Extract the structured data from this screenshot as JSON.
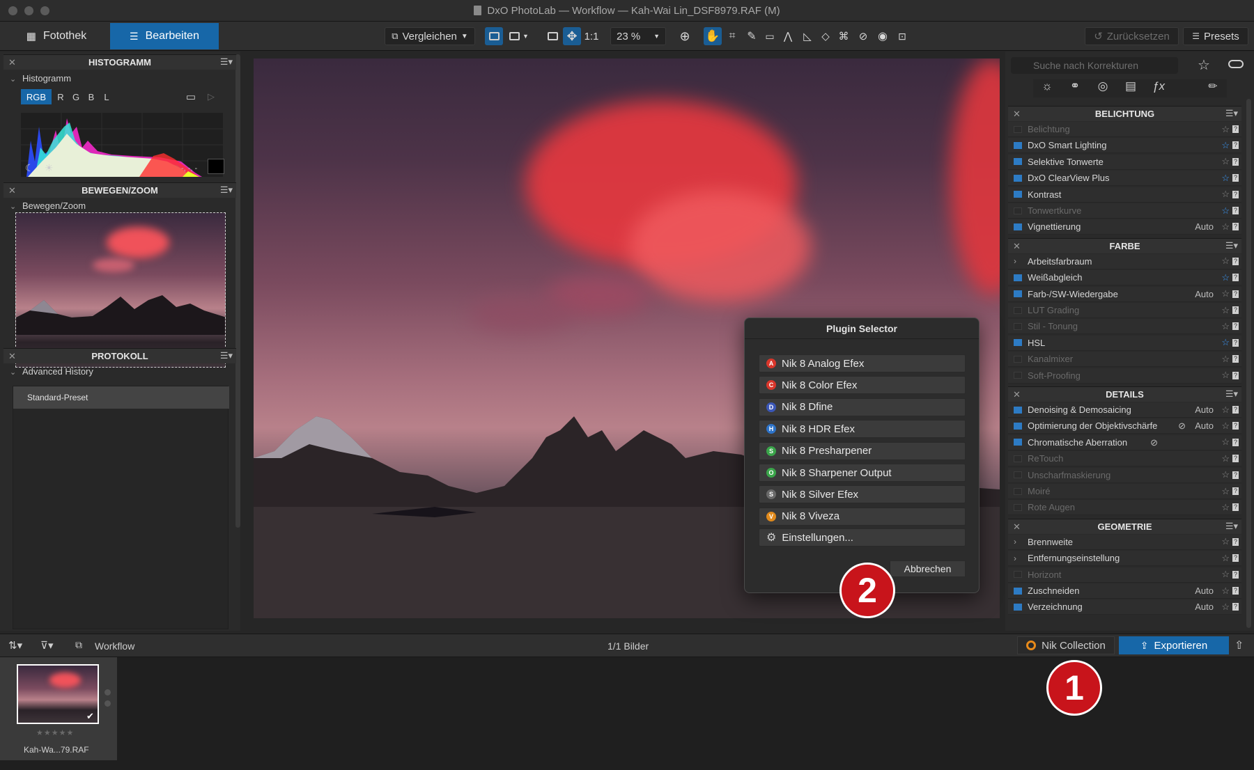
{
  "window": {
    "title": "DxO PhotoLab — Workflow — Kah-Wai Lin_DSF8979.RAF (M)"
  },
  "toolbar": {
    "tab_library": "Fotothek",
    "tab_edit": "Bearbeiten",
    "compare": "Vergleichen",
    "one_to_one": "1:1",
    "zoom": "23 %",
    "reset": "Zurücksetzen",
    "presets": "Presets"
  },
  "histogram": {
    "header": "HISTOGRAMM",
    "sub": "Histogramm",
    "channels": [
      "RGB",
      "R",
      "G",
      "B",
      "L"
    ],
    "readout": "-, -, -"
  },
  "navigator": {
    "header": "BEWEGEN/ZOOM",
    "sub": "Bewegen/Zoom"
  },
  "history": {
    "header": "PROTOKOLL",
    "sub": "Advanced History",
    "items": [
      "Standard-Preset"
    ]
  },
  "right": {
    "search_placeholder": "Suche nach Korrekturen",
    "sections": [
      {
        "title": "BELICHTUNG",
        "rows": [
          {
            "label": "Belichtung",
            "active": false,
            "starred": false,
            "auto": ""
          },
          {
            "label": "DxO Smart Lighting",
            "active": true,
            "starred": true,
            "auto": ""
          },
          {
            "label": "Selektive Tonwerte",
            "active": true,
            "starred": false,
            "auto": ""
          },
          {
            "label": "DxO ClearView Plus",
            "active": true,
            "starred": true,
            "auto": ""
          },
          {
            "label": "Kontrast",
            "active": true,
            "starred": false,
            "auto": ""
          },
          {
            "label": "Tonwertkurve",
            "active": false,
            "starred": true,
            "auto": ""
          },
          {
            "label": "Vignettierung",
            "active": true,
            "starred": false,
            "auto": "Auto"
          }
        ]
      },
      {
        "title": "FARBE",
        "rows": [
          {
            "label": "Arbeitsfarbraum",
            "chevron": true,
            "active": true,
            "starred": false,
            "auto": ""
          },
          {
            "label": "Weißabgleich",
            "active": true,
            "starred": true,
            "auto": ""
          },
          {
            "label": "Farb-/SW-Wiedergabe",
            "active": true,
            "starred": false,
            "auto": "Auto"
          },
          {
            "label": "LUT Grading",
            "active": false,
            "starred": false,
            "auto": ""
          },
          {
            "label": "Stil - Tonung",
            "active": false,
            "starred": false,
            "auto": ""
          },
          {
            "label": "HSL",
            "active": true,
            "starred": true,
            "auto": ""
          },
          {
            "label": "Kanalmixer",
            "active": false,
            "starred": false,
            "auto": ""
          },
          {
            "label": "Soft-Proofing",
            "active": false,
            "starred": false,
            "auto": ""
          }
        ]
      },
      {
        "title": "DETAILS",
        "rows": [
          {
            "label": "Denoising & Demosaicing",
            "active": true,
            "starred": false,
            "auto": "Auto"
          },
          {
            "label": "Optimierung der Objektivschärfe",
            "active": true,
            "starred": false,
            "auto": "Auto",
            "eye": true
          },
          {
            "label": "Chromatische Aberration",
            "active": true,
            "starred": false,
            "auto": "",
            "eye": true
          },
          {
            "label": "ReTouch",
            "active": false,
            "starred": false,
            "auto": ""
          },
          {
            "label": "Unscharfmaskierung",
            "active": false,
            "starred": false,
            "auto": ""
          },
          {
            "label": "Moiré",
            "active": false,
            "starred": false,
            "auto": ""
          },
          {
            "label": "Rote Augen",
            "active": false,
            "starred": false,
            "auto": ""
          }
        ]
      },
      {
        "title": "GEOMETRIE",
        "rows": [
          {
            "label": "Brennweite",
            "chevron": true,
            "active": true,
            "starred": false,
            "auto": ""
          },
          {
            "label": "Entfernungseinstellung",
            "chevron": true,
            "active": true,
            "starred": false,
            "auto": ""
          },
          {
            "label": "Horizont",
            "active": false,
            "starred": false,
            "auto": ""
          },
          {
            "label": "Zuschneiden",
            "active": true,
            "starred": false,
            "auto": "Auto"
          },
          {
            "label": "Verzeichnung",
            "active": true,
            "starred": false,
            "auto": "Auto"
          }
        ]
      }
    ]
  },
  "plugin_dialog": {
    "title": "Plugin Selector",
    "items": [
      {
        "label": "Nik 8 Analog Efex",
        "icon": "A",
        "color": "#d9362b"
      },
      {
        "label": "Nik 8 Color Efex",
        "icon": "C",
        "color": "#d9362b"
      },
      {
        "label": "Nik 8 Dfine",
        "icon": "D",
        "color": "#3b57b8"
      },
      {
        "label": "Nik 8 HDR Efex",
        "icon": "H",
        "color": "#2d73c8"
      },
      {
        "label": "Nik 8 Presharpener",
        "icon": "S",
        "color": "#3aa54a"
      },
      {
        "label": "Nik 8 Sharpener Output",
        "icon": "O",
        "color": "#3aa54a"
      },
      {
        "label": "Nik 8 Silver Efex",
        "icon": "S",
        "color": "#6a6a6a"
      },
      {
        "label": "Nik 8 Viveza",
        "icon": "V",
        "color": "#e08a1c"
      }
    ],
    "settings": "Einstellungen...",
    "cancel": "Abbrechen"
  },
  "badges": {
    "one": "1",
    "two": "2"
  },
  "bottombar": {
    "workflow": "Workflow",
    "count": "1/1 Bilder",
    "nik": "Nik Collection",
    "export": "Exportieren"
  },
  "filmstrip": {
    "filename": "Kah-Wa...79.RAF",
    "rating": "★★★★★"
  },
  "colors": {
    "accent": "#1767a8",
    "badge": "#c8141b"
  }
}
